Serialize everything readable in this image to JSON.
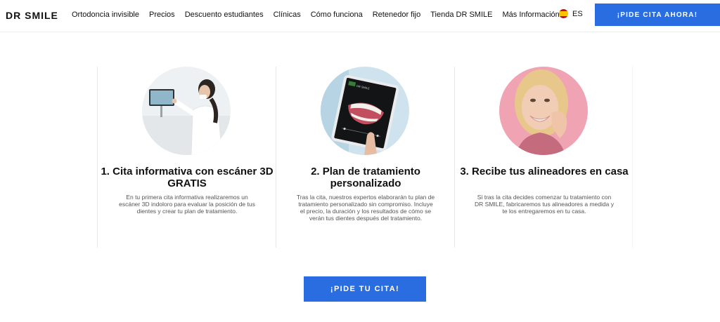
{
  "header": {
    "logo": "DR SMILE",
    "nav": [
      "Ortodoncia invisible",
      "Precios",
      "Descuento estudiantes",
      "Clínicas",
      "Cómo funciona",
      "Retenedor fijo",
      "Tienda DR SMILE"
    ],
    "more_label": "Más Información",
    "language": "ES",
    "cta": "¡PIDE CITA AHORA!"
  },
  "steps": [
    {
      "title": "1. Cita informativa con escáner 3D GRATIS",
      "description": "En tu primera cita informativa realizaremos un escáner 3D indoloro para evaluar la posición de tus dientes y crear tu plan de tratamiento."
    },
    {
      "title": "2. Plan de tratamiento personalizado",
      "description": "Tras la cita, nuestros expertos elaborarán tu plan de tratamiento personalizado sin compromiso. Incluye el precio, la duración y los resultados de cómo se verán tus dientes después del tratamiento.",
      "tablet_label": "DR SMILE"
    },
    {
      "title": "3. Recibe tus alineadores en casa",
      "description": "Si tras la cita decides comenzar tu tratamiento con DR SMILE, fabricaremos tus alineadores a medida y te los entregaremos en tu casa."
    }
  ],
  "cta_bottom": "¡PIDE TU CITA!",
  "colors": {
    "accent": "#2a6de0",
    "pink_bg": "#f0a3b3"
  }
}
